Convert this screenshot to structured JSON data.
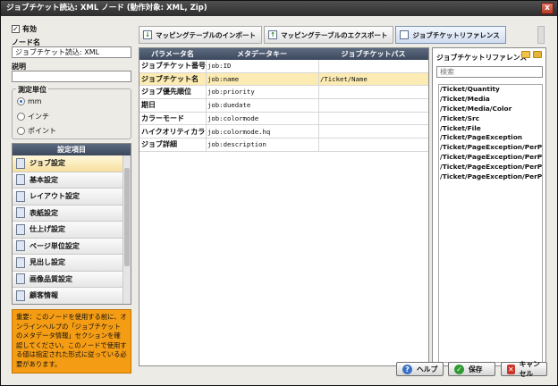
{
  "window": {
    "title": "ジョブチケット読込: XML ノード (動作対象: XML, Zip)",
    "close_glyph": "x"
  },
  "enabled": {
    "label": "有効",
    "checked": true
  },
  "node_name": {
    "label": "ノード名",
    "value": "ジョブチケット読込: XML"
  },
  "description": {
    "label": "説明",
    "value": ""
  },
  "unit": {
    "legend": "測定単位",
    "options": [
      {
        "label": "mm",
        "selected": true
      },
      {
        "label": "インチ",
        "selected": false
      },
      {
        "label": "ポイント",
        "selected": false
      }
    ]
  },
  "settings": {
    "header": "設定項目",
    "items": [
      {
        "label": "ジョブ設定",
        "selected": true
      },
      {
        "label": "基本設定",
        "selected": false
      },
      {
        "label": "レイアウト設定",
        "selected": false
      },
      {
        "label": "表紙設定",
        "selected": false
      },
      {
        "label": "仕上げ設定",
        "selected": false
      },
      {
        "label": "ページ単位設定",
        "selected": false
      },
      {
        "label": "見出し設定",
        "selected": false
      },
      {
        "label": "画像品質設定",
        "selected": false
      },
      {
        "label": "顧客情報",
        "selected": false
      }
    ]
  },
  "notice": "重要：このノードを使用する前に、オンラインヘルプの「ジョブチケットのメタデータ情報」セクションを確認してください。このノードで使用する値は指定された形式に従っている必要があります。",
  "tabs": [
    {
      "label": "マッピングテーブルのインポート",
      "active": false
    },
    {
      "label": "マッピングテーブルのエクスポート",
      "active": false
    },
    {
      "label": "ジョブチケットリファレンス",
      "active": true
    }
  ],
  "table": {
    "headers": [
      "パラメータ名",
      "メタデータキー",
      "ジョブチケットパス"
    ],
    "rows": [
      {
        "param": "ジョブチケット番号",
        "key": "job:ID",
        "path": "",
        "selected": false
      },
      {
        "param": "ジョブチケット名",
        "key": "job:name",
        "path": "/Ticket/Name",
        "selected": true
      },
      {
        "param": "ジョブ優先順位",
        "key": "job:priority",
        "path": "",
        "selected": false
      },
      {
        "param": "期日",
        "key": "job:duedate",
        "path": "",
        "selected": false
      },
      {
        "param": "カラーモード",
        "key": "job:colormode",
        "path": "",
        "selected": false
      },
      {
        "param": "ハイクオリティカラー",
        "key": "job:colormode.hq",
        "path": "",
        "selected": false
      },
      {
        "param": "ジョブ詳細",
        "key": "job:description",
        "path": "",
        "selected": false
      }
    ]
  },
  "reference": {
    "title": "ジョブチケットリファレンス",
    "search_placeholder": "検索",
    "items": [
      "/Ticket/Quantity",
      "/Ticket/Media",
      "/Ticket/Media/Color",
      "/Ticket/Src",
      "/Ticket/File",
      "/Ticket/PageException",
      "/Ticket/PageException/PerPage",
      "/Ticket/PageException/PerPage",
      "/Ticket/PageException/PerPage",
      "/Ticket/PageException/PerPage"
    ]
  },
  "buttons": {
    "help": "ヘルプ",
    "save": "保存",
    "cancel": "キャンセル"
  },
  "colors": {
    "accent_header": "#4a5870",
    "notice_bg": "#f49c14",
    "selected_row": "#fcebb2"
  }
}
